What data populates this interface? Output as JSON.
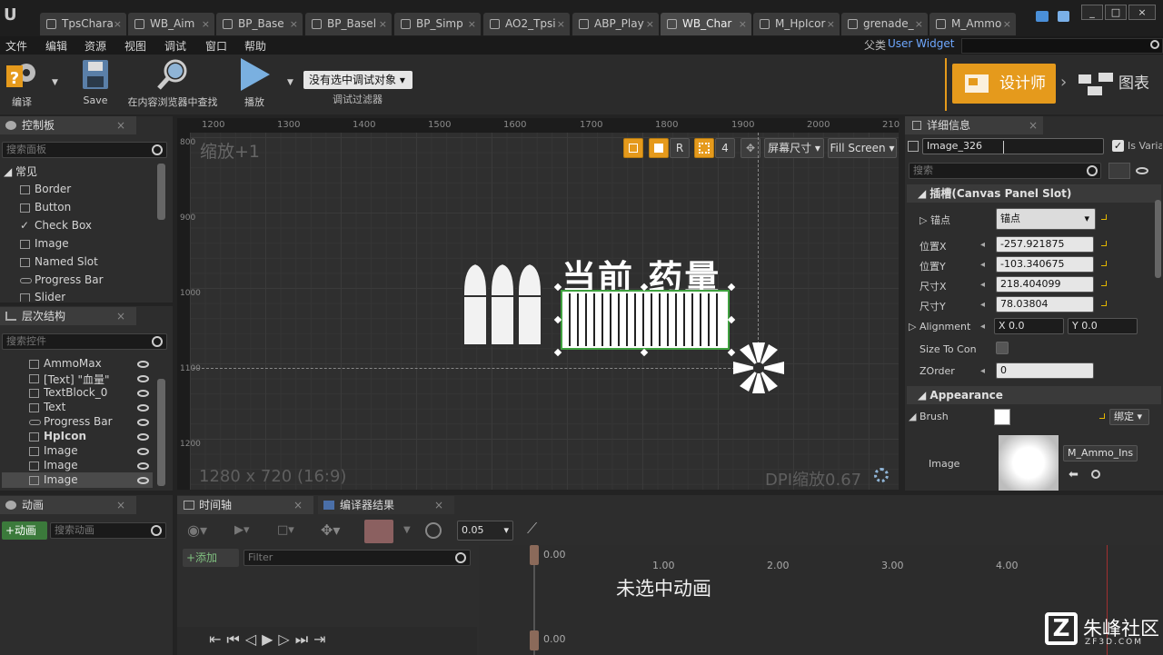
{
  "tabs": [
    {
      "label": "TpsChara"
    },
    {
      "label": "WB_Aim"
    },
    {
      "label": "BP_Base"
    },
    {
      "label": "BP_Basel"
    },
    {
      "label": "BP_Simp"
    },
    {
      "label": "AO2_Tpsi"
    },
    {
      "label": "ABP_Play"
    },
    {
      "label": "WB_Char"
    },
    {
      "label": "M_HpIcor"
    },
    {
      "label": "grenade_"
    },
    {
      "label": "M_Ammo"
    }
  ],
  "menu": [
    "文件",
    "编辑",
    "资源",
    "视图",
    "调试",
    "窗口",
    "帮助"
  ],
  "parent": {
    "label": "父类",
    "value": "User Widget"
  },
  "toolbar": {
    "compile": "编译",
    "save": "Save",
    "find": "在内容浏览器中查找",
    "play": "播放",
    "debug_select": "没有选中调试对象",
    "debug_filter": "调试过滤器",
    "designer": "设计师",
    "graph": "图表"
  },
  "palette": {
    "title": "控制板",
    "search_placeholder": "搜索面板",
    "category": "常见",
    "items": [
      "Border",
      "Button",
      "Check Box",
      "Image",
      "Named Slot",
      "Progress Bar",
      "Slider"
    ]
  },
  "hierarchy": {
    "title": "层次结构",
    "search_placeholder": "搜索控件",
    "items": [
      "AmmoMax",
      "[Text] \"血量\"",
      "TextBlock_0",
      "Text",
      "Progress Bar",
      "HpIcon",
      "Image",
      "Image",
      "Image"
    ]
  },
  "canvas": {
    "zoom": "缩放+1",
    "resolution": "1280 x 720 (16:9)",
    "dpi": "DPI缩放0.67",
    "screen_size": "屏幕尺寸",
    "fill_screen": "Fill Screen",
    "num": "4",
    "r_label": "R",
    "title_text": "当前 药量",
    "ruler_top": [
      "1200",
      "1300",
      "1400",
      "1500",
      "1600",
      "1700",
      "1800",
      "1900",
      "2000",
      "210"
    ],
    "ruler_left": [
      {
        "t": "800"
      },
      {
        "t": "900"
      },
      {
        "t": "1000"
      },
      {
        "t": "1100"
      },
      {
        "t": "1200"
      }
    ]
  },
  "details": {
    "title": "详细信息",
    "name": "Image_326",
    "is_variable": "Is Varia",
    "search_placeholder": "搜索",
    "slot_section": "插槽(Canvas Panel Slot)",
    "anchor_label": "锚点",
    "anchor_value": "锚点",
    "pos_x_label": "位置X",
    "pos_x": "-257.921875",
    "pos_y_label": "位置Y",
    "pos_y": "-103.340675",
    "size_x_label": "尺寸X",
    "size_x": "218.404099",
    "size_y_label": "尺寸Y",
    "size_y": "78.03804",
    "alignment_label": "Alignment",
    "align_x": "X 0.0",
    "align_y": "Y 0.0",
    "size_content_label": "Size To Con",
    "zorder_label": "ZOrder",
    "zorder": "0",
    "appearance_section": "Appearance",
    "brush_label": "Brush",
    "bind": "绑定",
    "image_label": "Image",
    "image_asset": "M_Ammo_Ins"
  },
  "animation": {
    "title": "动画",
    "add": "+动画",
    "search_placeholder": "搜索动画"
  },
  "timeline": {
    "tab_timeline": "时间轴",
    "tab_compiler": "编译器结果",
    "add": "+添加",
    "filter_placeholder": "Filter",
    "step": "0.05",
    "no_animation": "未选中动画",
    "ticks": [
      "0.00",
      "1.00",
      "2.00",
      "3.00",
      "4.00"
    ]
  },
  "watermark": {
    "text": "朱峰社区",
    "sub": "ZF3D.COM"
  },
  "colors": {
    "accent": "#e59a1c",
    "selection": "#3fa13f",
    "link": "#6fa8ff"
  }
}
